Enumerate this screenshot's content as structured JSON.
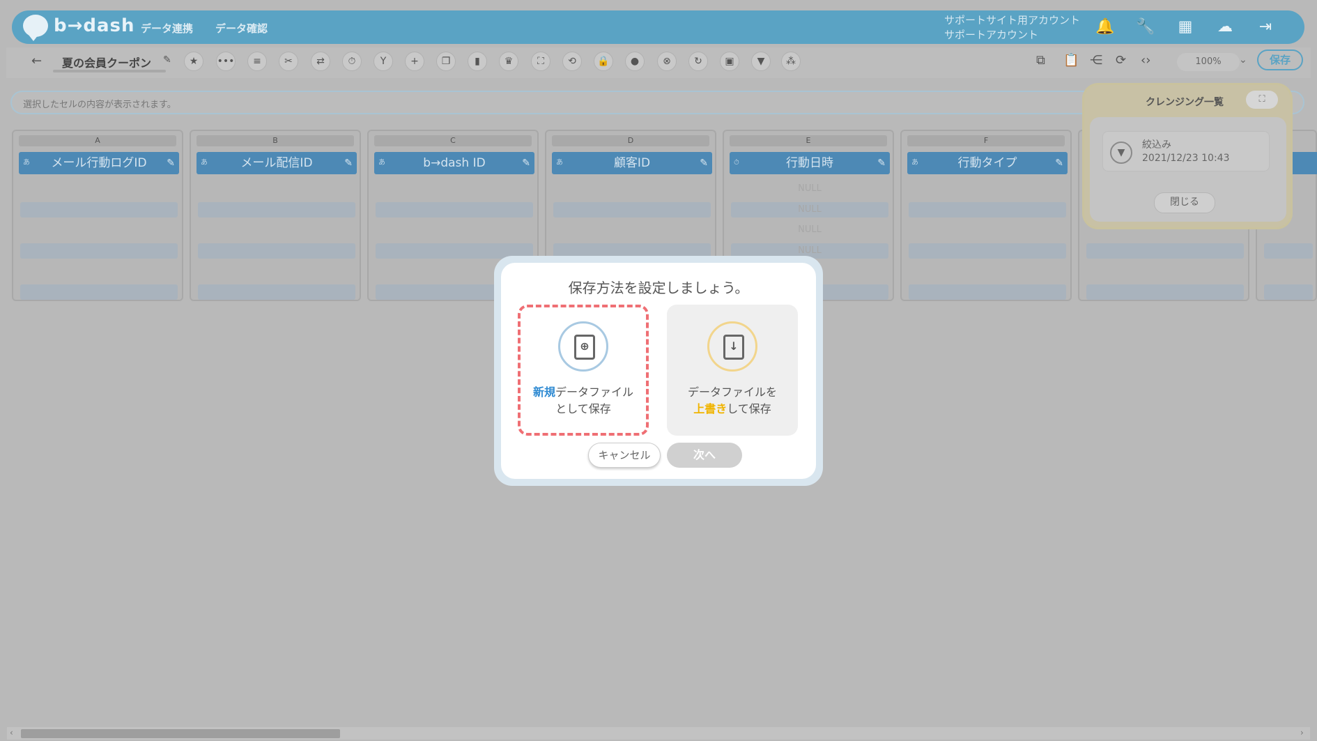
{
  "header": {
    "logo": "b→dash",
    "nav": [
      "データ連携",
      "データ確認"
    ],
    "account_line1": "サポートサイト用アカウント",
    "account_line2": "サポートアカウント",
    "icons": [
      "bell-icon",
      "wrench-icon",
      "grid-icon",
      "cloud-icon",
      "logout-icon"
    ]
  },
  "toolbar": {
    "back_icon": "←",
    "file_name": "夏の会員クーポン",
    "zoom": "100%",
    "save_label": "保存"
  },
  "cell_bar": {
    "placeholder": "選択したセルの内容が表示されます。"
  },
  "columns": [
    {
      "letter": "A",
      "type": "あ",
      "name": "メール行動ログID"
    },
    {
      "letter": "B",
      "type": "あ",
      "name": "メール配信ID"
    },
    {
      "letter": "C",
      "type": "あ",
      "name": "b→dash ID"
    },
    {
      "letter": "D",
      "type": "あ",
      "name": "顧客ID"
    },
    {
      "letter": "E",
      "type": "⏱",
      "name": "行動日時"
    },
    {
      "letter": "F",
      "type": "あ",
      "name": "行動タイプ"
    }
  ],
  "null_label": "NULL",
  "cleansing": {
    "title": "クレンジング一覧",
    "item_label": "絞込み",
    "item_date": "2021/12/23 10:43",
    "close_label": "閉じる"
  },
  "modal": {
    "title": "保存方法を設定しましょう。",
    "new_hl": "新規",
    "new_rest": "データファイル",
    "new_line2": "として保存",
    "over_line1": "データファイルを",
    "over_hl": "上書き",
    "over_rest": "して保存",
    "cancel": "キャンセル",
    "next": "次へ"
  },
  "colors": {
    "header": "#5aa3c4",
    "column_header": "#4d89b5",
    "highlight_dash": "#ef6f74",
    "new_accent": "#2e8ad2",
    "overwrite_accent": "#f0b400"
  }
}
